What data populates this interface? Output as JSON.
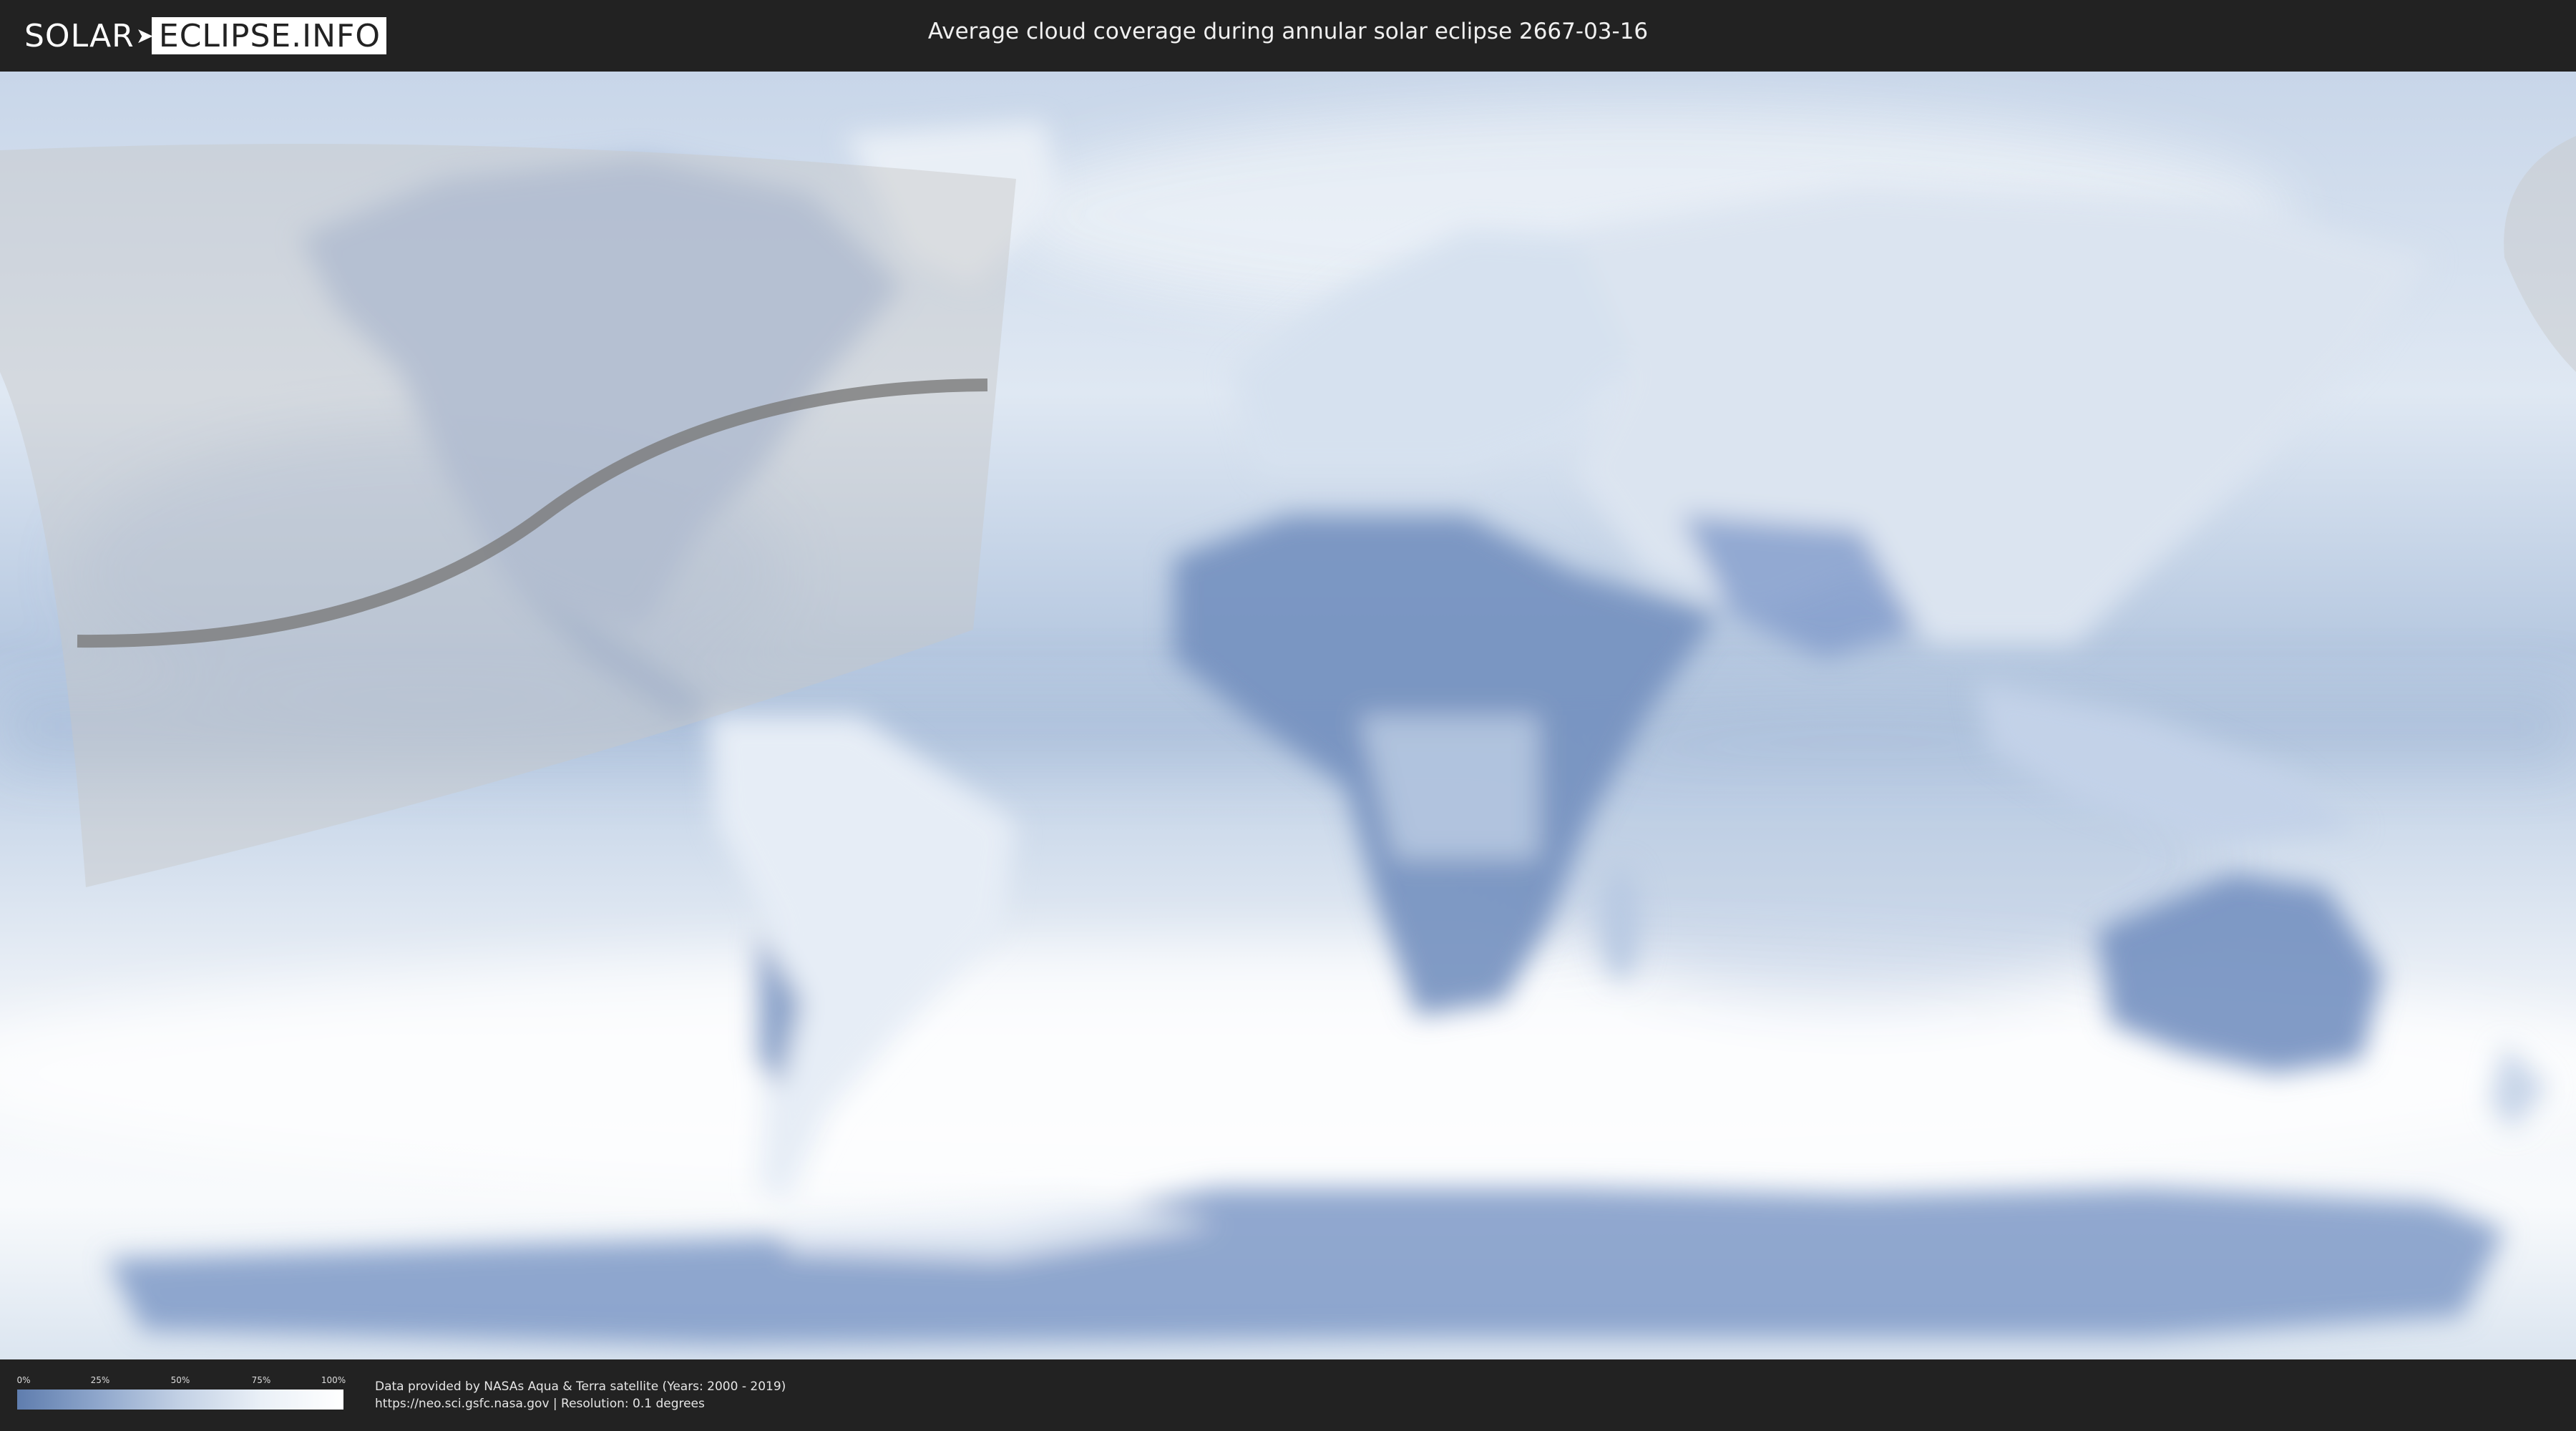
{
  "header": {
    "logo_left": "SOLAR",
    "logo_right": "ECLIPSE.INFO",
    "title": "Average cloud coverage during annular solar eclipse 2667-03-16"
  },
  "legend": {
    "ticks": [
      "0%",
      "25%",
      "50%",
      "75%",
      "100%"
    ],
    "colors": [
      "#5f7dae",
      "#8fa7cc",
      "#c3d1e5",
      "#eaf0f7",
      "#ffffff"
    ]
  },
  "footer": {
    "credit_line": "Data provided by NASAs Aqua & Terra satellite (Years: 2000 - 2019)",
    "source_line": "https://neo.sci.gsfc.nasa.gov | Resolution: 0.1 degrees"
  },
  "map": {
    "projection": "equirectangular",
    "eclipse_type": "annular",
    "colors": {
      "ocean_clear": "#b9cbe2",
      "ocean_cloudy": "#eef3f9",
      "land_low_cloud": "#6e8bbb",
      "eclipse_zone": "#c7c7c7",
      "central_line": "#7a7a7a"
    }
  }
}
